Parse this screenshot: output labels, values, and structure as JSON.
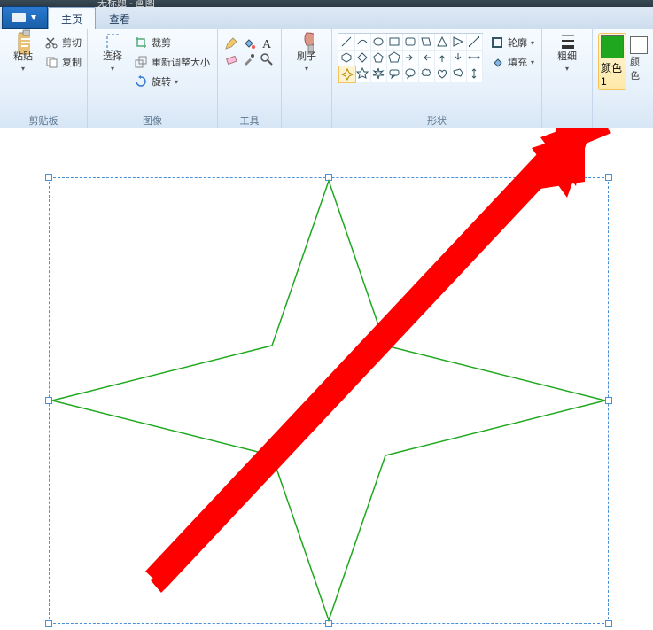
{
  "window_title": "无标题 - 画图",
  "tabs": {
    "home": "主页",
    "view": "查看"
  },
  "groups": {
    "clipboard": {
      "label": "剪贴板",
      "paste": "粘贴",
      "cut": "剪切",
      "copy": "复制"
    },
    "image": {
      "label": "图像",
      "select": "选择",
      "crop": "裁剪",
      "resize": "重新调整大小",
      "rotate": "旋转"
    },
    "tools": {
      "label": "工具"
    },
    "brush": {
      "label": "刷子"
    },
    "shapes": {
      "label": "形状",
      "outline": "轮廓",
      "fill": "填充"
    },
    "size": {
      "label": "粗细"
    },
    "colors": {
      "color1": "颜色 1",
      "color2": "颜色",
      "color1_value": "#1fa81f",
      "color2_value": "#ffffff"
    }
  },
  "canvas_shape": {
    "type": "four-point-star",
    "stroke": "#1fa81f"
  },
  "annotation": {
    "arrow_color": "#ff0000"
  }
}
